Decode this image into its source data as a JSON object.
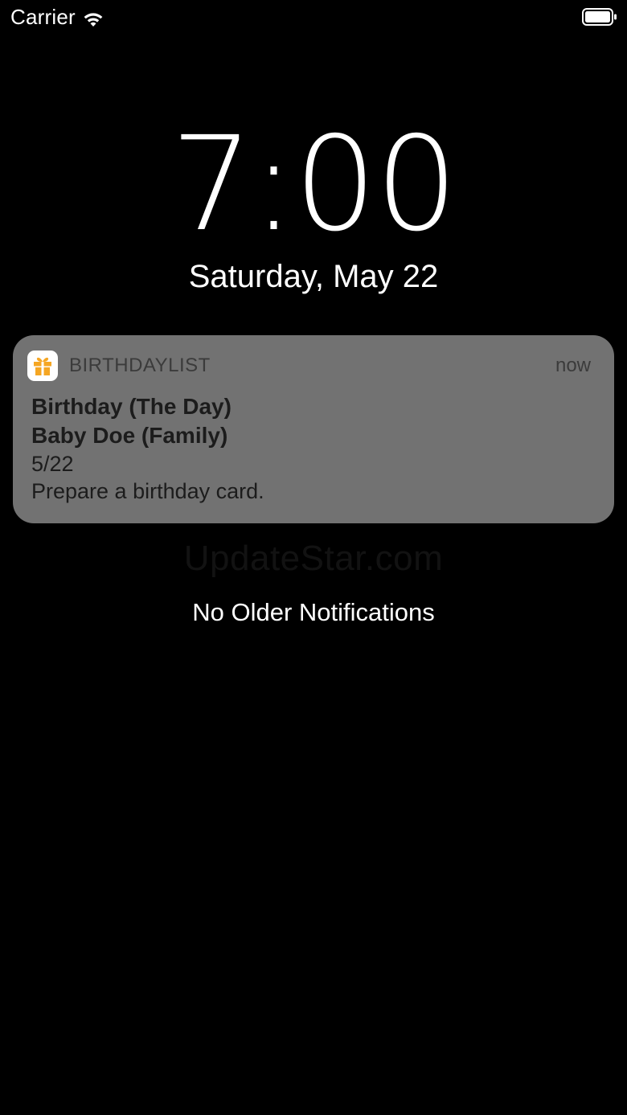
{
  "status_bar": {
    "carrier": "Carrier",
    "wifi_icon": "wifi-icon",
    "battery_icon": "battery-icon"
  },
  "lock_screen": {
    "time": "7:00",
    "date": "Saturday, May 22"
  },
  "notification": {
    "app_icon": "gift-icon",
    "app_name": "BIRTHDAYLIST",
    "time": "now",
    "title": "Birthday (The Day)",
    "subtitle": "Baby Doe (Family)",
    "date": "5/22",
    "body": "Prepare a birthday card.",
    "background_color": "#727272",
    "icon_color": "#f5a623"
  },
  "watermark": "UpdateStar.com",
  "no_older_label": "No Older Notifications"
}
